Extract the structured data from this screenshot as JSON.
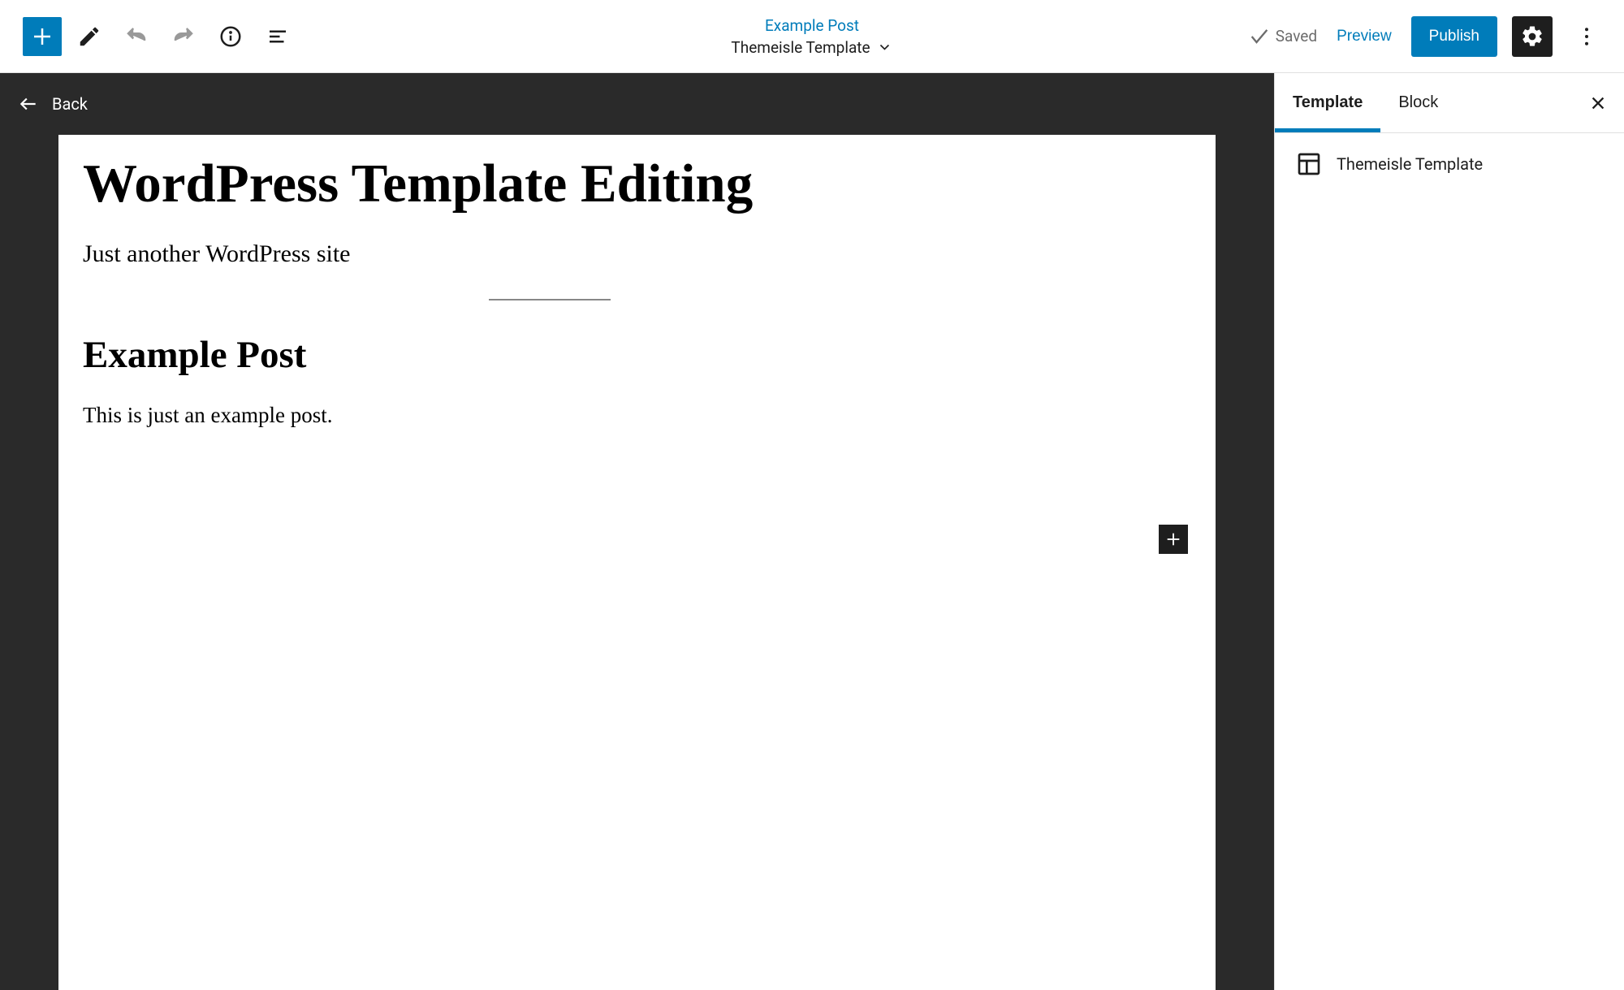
{
  "header": {
    "post_link_text": "Example Post",
    "template_name": "Themeisle Template",
    "saved_label": "Saved",
    "preview_label": "Preview",
    "publish_label": "Publish"
  },
  "back_bar": {
    "label": "Back"
  },
  "canvas": {
    "site_title": "WordPress Template Editing",
    "site_tagline": "Just another WordPress site",
    "post_heading": "Example Post",
    "post_body": "This is just an example post."
  },
  "sidebar": {
    "tabs": {
      "template": "Template",
      "block": "Block"
    },
    "template_name": "Themeisle Template"
  }
}
